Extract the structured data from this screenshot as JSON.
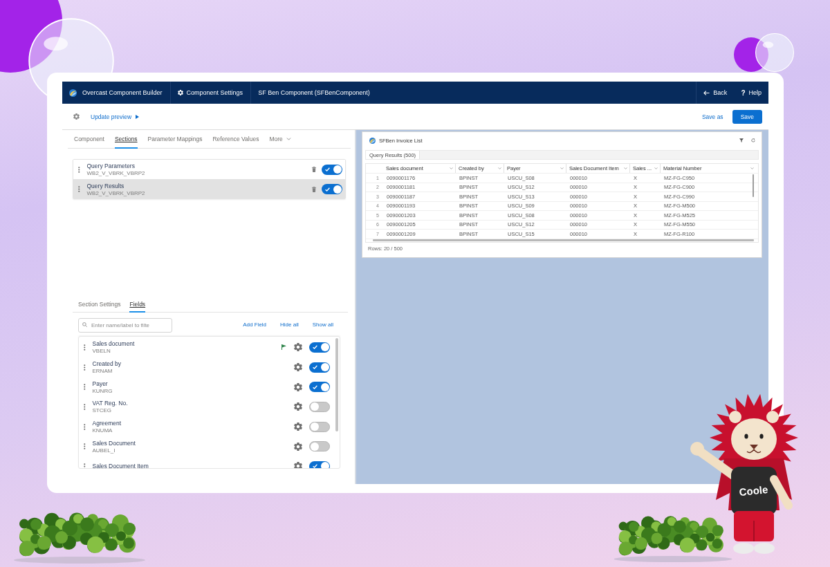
{
  "header": {
    "app_title": "Overcast Component Builder",
    "settings_link": "Component Settings",
    "component_name": "SF Ben Component (SFBenComponent)",
    "back": "Back",
    "help": {
      "icon": "?",
      "label": "Help"
    }
  },
  "toolbar": {
    "update_preview": "Update preview",
    "save_as": "Save as",
    "save": "Save"
  },
  "config_tabs": [
    {
      "label": "Component",
      "kind": "tab",
      "selected": false
    },
    {
      "label": "Sections",
      "kind": "tab",
      "selected": true
    },
    {
      "label": "Parameter Mappings",
      "kind": "tab",
      "selected": false
    },
    {
      "label": "Reference Values",
      "kind": "tab",
      "selected": false
    },
    {
      "label": "More",
      "kind": "menu",
      "selected": false
    }
  ],
  "sections": [
    {
      "title": "Query Parameters",
      "table": "WB2_V_VBRK_VBRP2",
      "selected": false,
      "on": true
    },
    {
      "title": "Query Results",
      "table": "WB2_V_VBRK_VBRP2",
      "selected": true,
      "on": true
    }
  ],
  "section_tabs": [
    {
      "label": "Section Settings",
      "selected": false
    },
    {
      "label": "Fields",
      "selected": true
    }
  ],
  "field_search": {
    "placeholder": "Enter name/label to filte"
  },
  "field_actions": [
    "Add Field",
    "Hide all",
    "Show all"
  ],
  "fields": [
    {
      "label": "Sales document",
      "name": "VBELN",
      "flagged": true,
      "on": true
    },
    {
      "label": "Created by",
      "name": "ERNAM",
      "flagged": false,
      "on": true
    },
    {
      "label": "Payer",
      "name": "KUNRG",
      "flagged": false,
      "on": true
    },
    {
      "label": "VAT Reg. No.",
      "name": "STCEG",
      "flagged": false,
      "on": false
    },
    {
      "label": "Agreement",
      "name": "KNUMA",
      "flagged": false,
      "on": false
    },
    {
      "label": "Sales Document",
      "name": "AUBEL_I",
      "flagged": false,
      "on": false
    },
    {
      "label": "Sales Document Item",
      "flagged": false,
      "on": true
    }
  ],
  "preview": {
    "title": "SFBen Invoice List",
    "tab": "Query Results (500)",
    "columns": [
      "Sales document",
      "Created by",
      "Payer",
      "Sales Document Item",
      "Sales ...",
      "Material Number"
    ],
    "rows": [
      {
        "number": "1",
        "cells": [
          "0090001176",
          "BPINST",
          "USCU_S08",
          "000010",
          "X",
          "MZ-FG-C950"
        ]
      },
      {
        "number": "2",
        "cells": [
          "0090001181",
          "BPINST",
          "USCU_S12",
          "000010",
          "X",
          "MZ-FG-C900"
        ]
      },
      {
        "number": "3",
        "cells": [
          "0090001187",
          "BPINST",
          "USCU_S13",
          "000010",
          "X",
          "MZ-FG-C990"
        ]
      },
      {
        "number": "4",
        "cells": [
          "0090001193",
          "BPINST",
          "USCU_S09",
          "000010",
          "X",
          "MZ-FG-M500"
        ]
      },
      {
        "number": "5",
        "cells": [
          "0090001203",
          "BPINST",
          "USCU_S08",
          "000010",
          "X",
          "MZ-FG-M525"
        ]
      },
      {
        "number": "6",
        "cells": [
          "0090001205",
          "BPINST",
          "USCU_S12",
          "000010",
          "X",
          "MZ-FG-M550"
        ]
      },
      {
        "number": "7",
        "cells": [
          "0090001209",
          "BPINST",
          "USCU_S15",
          "000010",
          "X",
          "MZ-FG-R100"
        ]
      }
    ],
    "footer": "Rows: 20 / 500"
  },
  "mascot": {
    "shirt_text": "Coole"
  }
}
